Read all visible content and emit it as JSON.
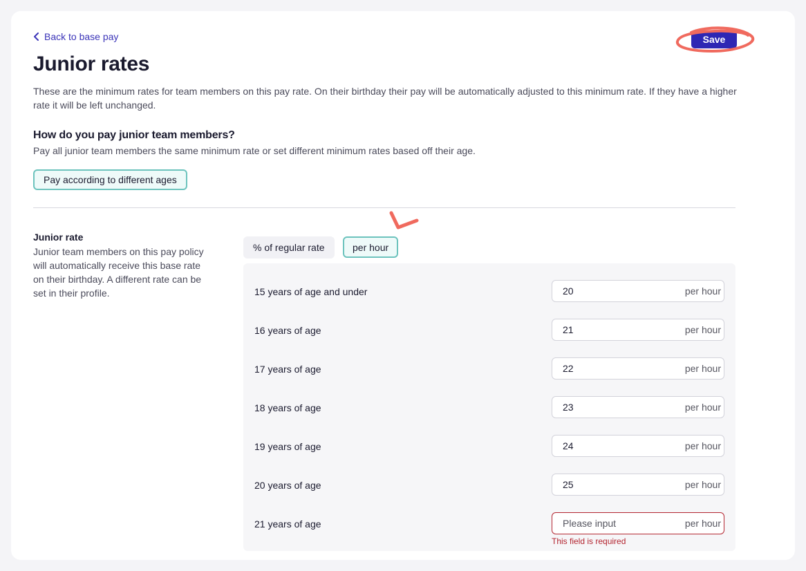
{
  "header": {
    "back_link": "Back to base pay",
    "save_label": "Save",
    "title": "Junior rates",
    "intro": "These are the minimum rates for team members on this pay rate. On their birthday their pay will be automatically adjusted to this minimum rate. If they have a higher rate it will be left unchanged."
  },
  "payment_question": {
    "title": "How do you pay junior team members?",
    "description": "Pay all junior team members the same minimum rate or set different minimum rates based off their age.",
    "selected_option": "Pay according to different ages"
  },
  "junior_rate": {
    "title": "Junior rate",
    "description": "Junior team members on this pay policy will automatically receive this base rate on their birthday. A different rate can be set in their profile.",
    "toggle_percent": "% of regular rate",
    "toggle_hour": "per hour",
    "selected_toggle": "per hour",
    "rows": [
      {
        "label": "15 years of age and under",
        "value": "20",
        "suffix": "per hour"
      },
      {
        "label": "16 years of age",
        "value": "21",
        "suffix": "per hour"
      },
      {
        "label": "17 years of age",
        "value": "22",
        "suffix": "per hour"
      },
      {
        "label": "18 years of age",
        "value": "23",
        "suffix": "per hour"
      },
      {
        "label": "19 years of age",
        "value": "24",
        "suffix": "per hour"
      },
      {
        "label": "20 years of age",
        "value": "25",
        "suffix": "per hour"
      },
      {
        "label": "21 years of age",
        "value": "",
        "placeholder": "Please input",
        "suffix": "per hour",
        "error": "This field is required"
      }
    ]
  },
  "colors": {
    "accent": "#2e27b4",
    "selected_border": "#6cc3bd",
    "selected_bg": "#eefaf9",
    "error": "#b3242f",
    "annotation": "#f06a5e"
  }
}
